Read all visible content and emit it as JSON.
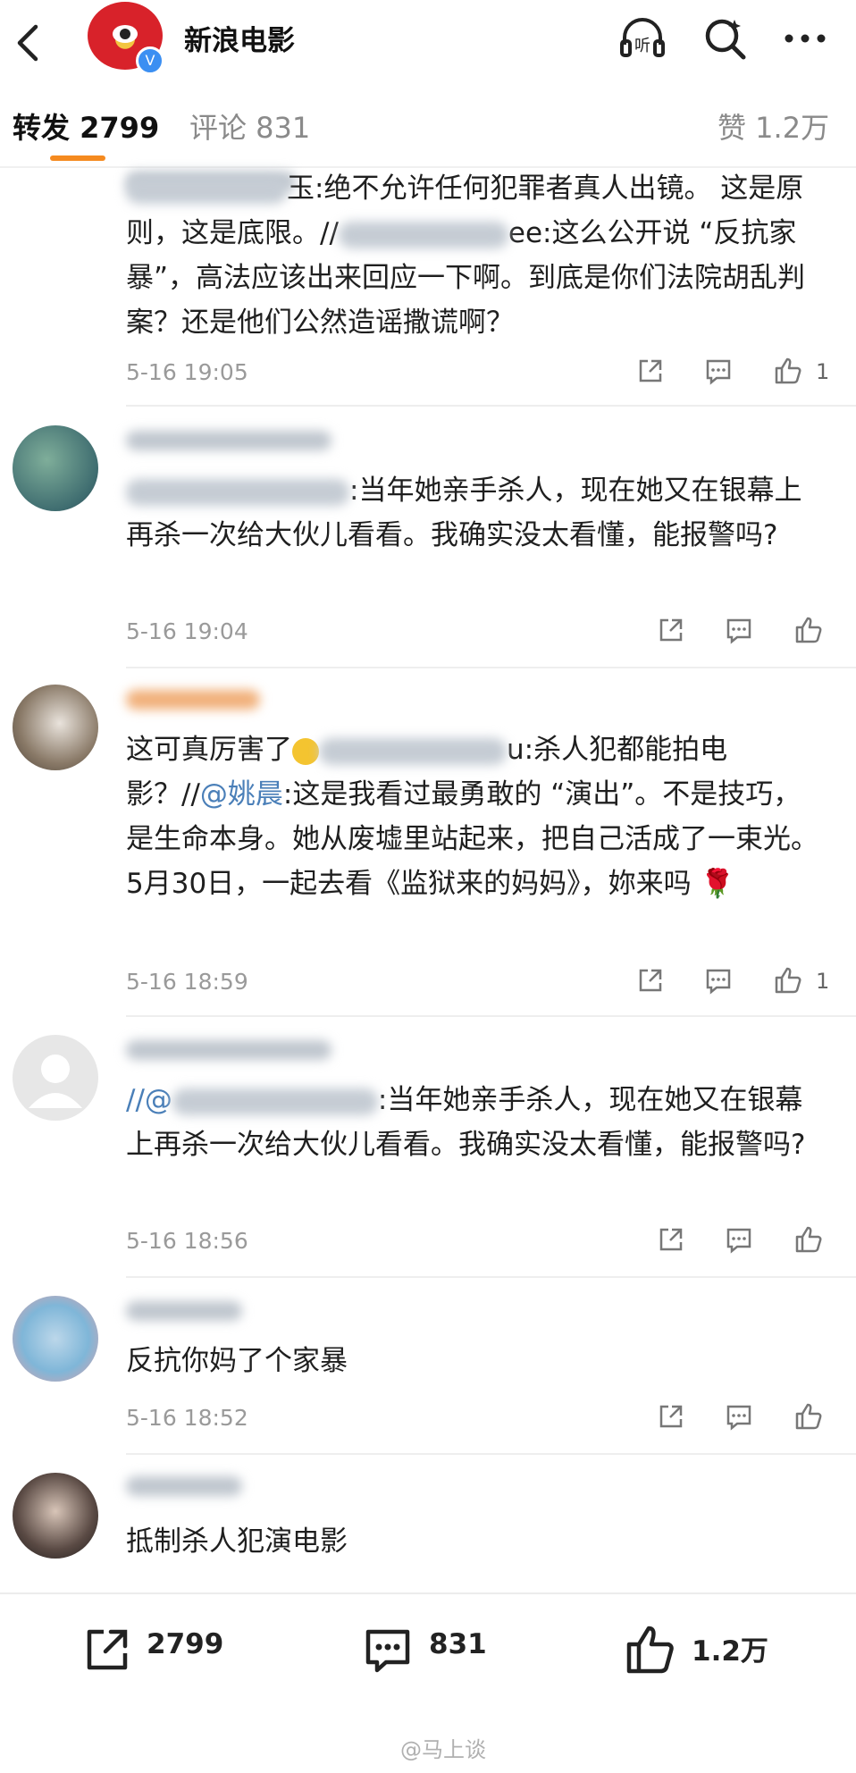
{
  "header": {
    "title": "新浪电影",
    "verified_mark": "V"
  },
  "tabs": {
    "repost": "转发 2799",
    "comment": "评论 831",
    "like": "赞 1.2万"
  },
  "comments": [
    {
      "seg1": "玉:绝不允许任何犯罪者真人出镜。 这是原则，这是底限。//",
      "seg2": "ee:这么公开说 “反抗家暴”，高法应该出来回应一下啊。到底是你们法院胡乱判案？还是他们公然造谣撒谎啊？",
      "time": "5-16 19:05",
      "likes": "1"
    },
    {
      "seg1": "",
      "seg2": ":当年她亲手杀人，现在她又在银幕上再杀一次给大伙儿看看。我确实没太看懂，能报警吗?",
      "time": "5-16 19:04",
      "likes": ""
    },
    {
      "seg1": "这可真厉害了",
      "seg2": "u:杀人犯都能拍电影？//",
      "mention": "@姚晨",
      "seg3": ":这是我看过最勇敢的 “演出”。不是技巧，是生命本身。她从废墟里站起来，把自己活成了一束光。5月30日，一起去看《监狱来的妈妈》，妳来吗",
      "time": "5-16 18:59",
      "likes": "1"
    },
    {
      "seg1": "//@",
      "seg2": ":当年她亲手杀人，现在她又在银幕上再杀一次给大伙儿看看。我确实没太看懂，能报警吗?",
      "time": "5-16 18:56",
      "likes": ""
    },
    {
      "seg1": "反抗你妈了个家暴",
      "time": "5-16 18:52",
      "likes": ""
    },
    {
      "seg1": "抵制杀人犯演电影",
      "time": "",
      "likes": ""
    }
  ],
  "bottom_bar": {
    "repost_count": "2799",
    "comment_count": "831",
    "like_count": "1.2万"
  },
  "watermark": "@马上谈",
  "colors": {
    "accent": "#f58a1f",
    "link": "#4a7fb8",
    "meta": "#9a9a9a"
  }
}
